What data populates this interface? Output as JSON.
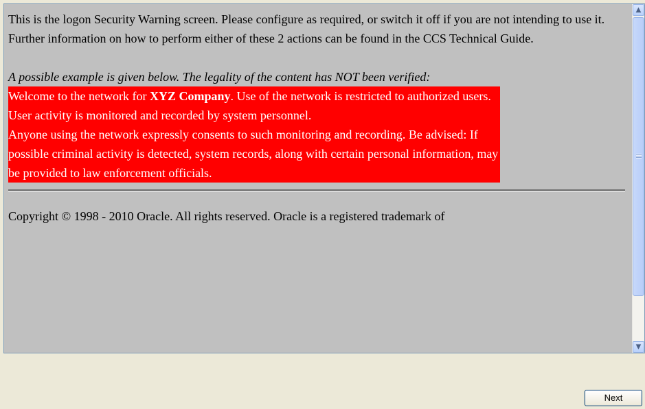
{
  "content": {
    "intro_line1": "This is the logon Security Warning screen. Please configure as required, or switch it off if you are not intending to use it.",
    "intro_line2": "Further information on how to perform either of these 2 actions can be found in the CCS Technical Guide.",
    "example_note": "A possible example is given below. The legality of the content has NOT been verified:",
    "warning_pre": "Welcome to the network for ",
    "warning_company": "XYZ Company",
    "warning_post": ". Use of the network is restricted to authorized users. User activity is monitored and recorded by system personnel.",
    "warning_line2": "Anyone using the network expressly consents to such monitoring and recording. Be advised: If possible criminal activity is detected, system records, along with certain personal information, may be provided to law enforcement officials.",
    "copyright": "Copyright © 1998 - 2010 Oracle. All rights reserved. Oracle is a registered trademark of"
  },
  "scrollbar": {
    "up_icon": "scroll-up-arrow",
    "down_icon": "scroll-down-arrow"
  },
  "buttons": {
    "next_label": "Next"
  }
}
